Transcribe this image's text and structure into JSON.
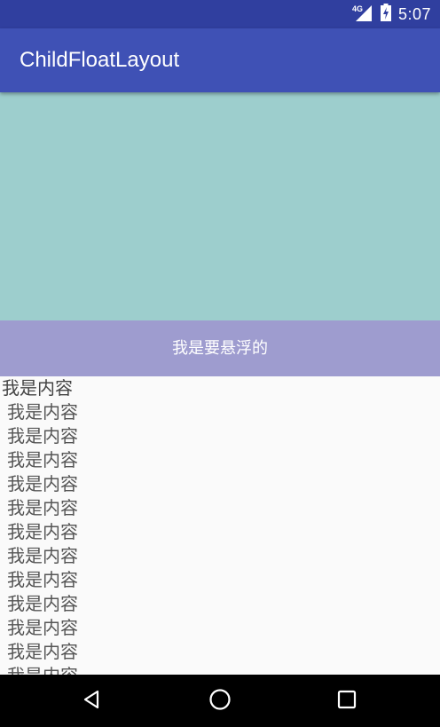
{
  "status_bar": {
    "network_label": "4G",
    "time": "5:07",
    "icons": [
      "signal-icon",
      "battery-icon"
    ]
  },
  "app_bar": {
    "title": "ChildFloatLayout"
  },
  "float_bar": {
    "label": "我是要悬浮的"
  },
  "content": {
    "items": [
      "我是内容",
      "我是内容",
      "我是内容",
      "我是内容",
      "我是内容",
      "我是内容",
      "我是内容",
      "我是内容",
      "我是内容",
      "我是内容",
      "我是内容",
      "我是内容",
      "我是内容"
    ]
  },
  "nav_bar": {
    "icons": [
      "back-icon",
      "home-icon",
      "recents-icon"
    ]
  },
  "colors": {
    "status_bar": "#303f9f",
    "app_bar": "#3f51b5",
    "header_area": "#9dcecd",
    "float_bar": "#9e9ccf",
    "content_bg": "#fafafa",
    "content_text": "#555555"
  }
}
